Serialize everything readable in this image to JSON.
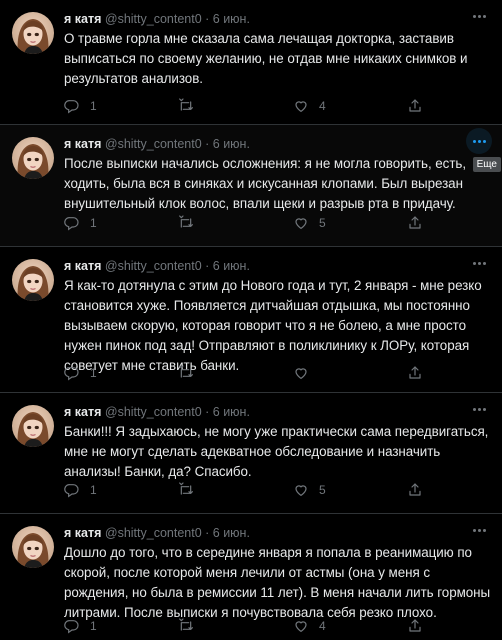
{
  "colors": {
    "background": "#000000",
    "text": "#e7e9ea",
    "muted": "#71767b",
    "divider": "#2f3336",
    "accent": "#1d9bf0"
  },
  "icons": {
    "reply": "reply-icon",
    "retweet": "retweet-icon",
    "like": "like-icon",
    "share": "share-icon",
    "more": "more-dots-icon"
  },
  "tweets": [
    {
      "name": "я катя",
      "handle": "@shitty_content0",
      "sep": " · ",
      "date": "6 июн.",
      "text": "О травме горла мне сказала сама лечащая докторка, заставив выписаться по своему желанию, не отдав мне никаких снимков и результатов анализов.",
      "replies": "1",
      "retweets": "",
      "likes": "4"
    },
    {
      "name": "я катя",
      "handle": "@shitty_content0",
      "sep": " · ",
      "date": "6 июн.",
      "text": "После выписки начались осложнения: я не могла говорить, есть, ходить, была вся в синяках и искусанная клопами. Был вырезан внушительный клок волос, впали щеки и разрыв рта в придачу.",
      "replies": "1",
      "retweets": "",
      "likes": "5",
      "tooltip": "Еще"
    },
    {
      "name": "я катя",
      "handle": "@shitty_content0",
      "sep": " · ",
      "date": "6 июн.",
      "text": "Я как-то дотянула с этим до Нового года и тут, 2 января - мне резко становится хуже. Появляется дитчайшая отдышка, мы постоянно вызываем скорую, которая говорит что я не болею, а мне просто нужен пинок под зад! Отправляют в поликлинику к ЛОРу, которая советует мне ставить банки.",
      "replies": "1",
      "retweets": "",
      "likes": ""
    },
    {
      "name": "я катя",
      "handle": "@shitty_content0",
      "sep": " · ",
      "date": "6 июн.",
      "text": "Банки!!! Я задыхаюсь, не могу уже практически сама передвигаться, мне не могут сделать адекватное обследование и назначить анализы! Банки, да? Спасибо.",
      "replies": "1",
      "retweets": "",
      "likes": "5"
    },
    {
      "name": "я катя",
      "handle": "@shitty_content0",
      "sep": " · ",
      "date": "6 июн.",
      "text": "Дошло до того, что в середине января я попала в реанимацию по скорой, после которой меня лечили от астмы (она у меня с рождения, но была в ремиссии 11 лет). В меня начали лить гормоны литрами. После выписки я почувствовала себя резко плохо.",
      "replies": "1",
      "retweets": "",
      "likes": "4"
    }
  ]
}
